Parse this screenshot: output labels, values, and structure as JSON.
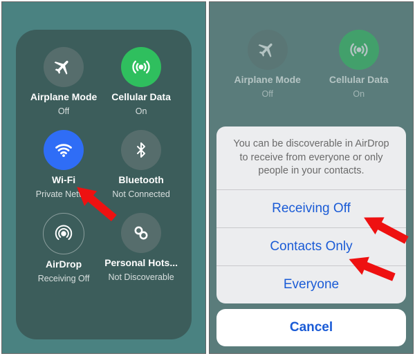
{
  "left": {
    "airplane": {
      "label": "Airplane Mode",
      "status": "Off"
    },
    "cellular": {
      "label": "Cellular Data",
      "status": "On"
    },
    "wifi": {
      "label": "Wi-Fi",
      "status": "Private Netw..."
    },
    "bluetooth": {
      "label": "Bluetooth",
      "status": "Not Connected"
    },
    "airdrop": {
      "label": "AirDrop",
      "status": "Receiving Off"
    },
    "hotspot": {
      "label": "Personal Hots...",
      "status": "Not Discoverable"
    }
  },
  "right": {
    "bg_airplane": {
      "label": "Airplane Mode",
      "status": "Off"
    },
    "bg_cellular": {
      "label": "Cellular Data",
      "status": "On"
    },
    "sheet": {
      "message": "You can be discoverable in AirDrop to receive from everyone or only people in your contacts.",
      "opt1": "Receiving Off",
      "opt2": "Contacts Only",
      "opt3": "Everyone",
      "cancel": "Cancel"
    }
  }
}
